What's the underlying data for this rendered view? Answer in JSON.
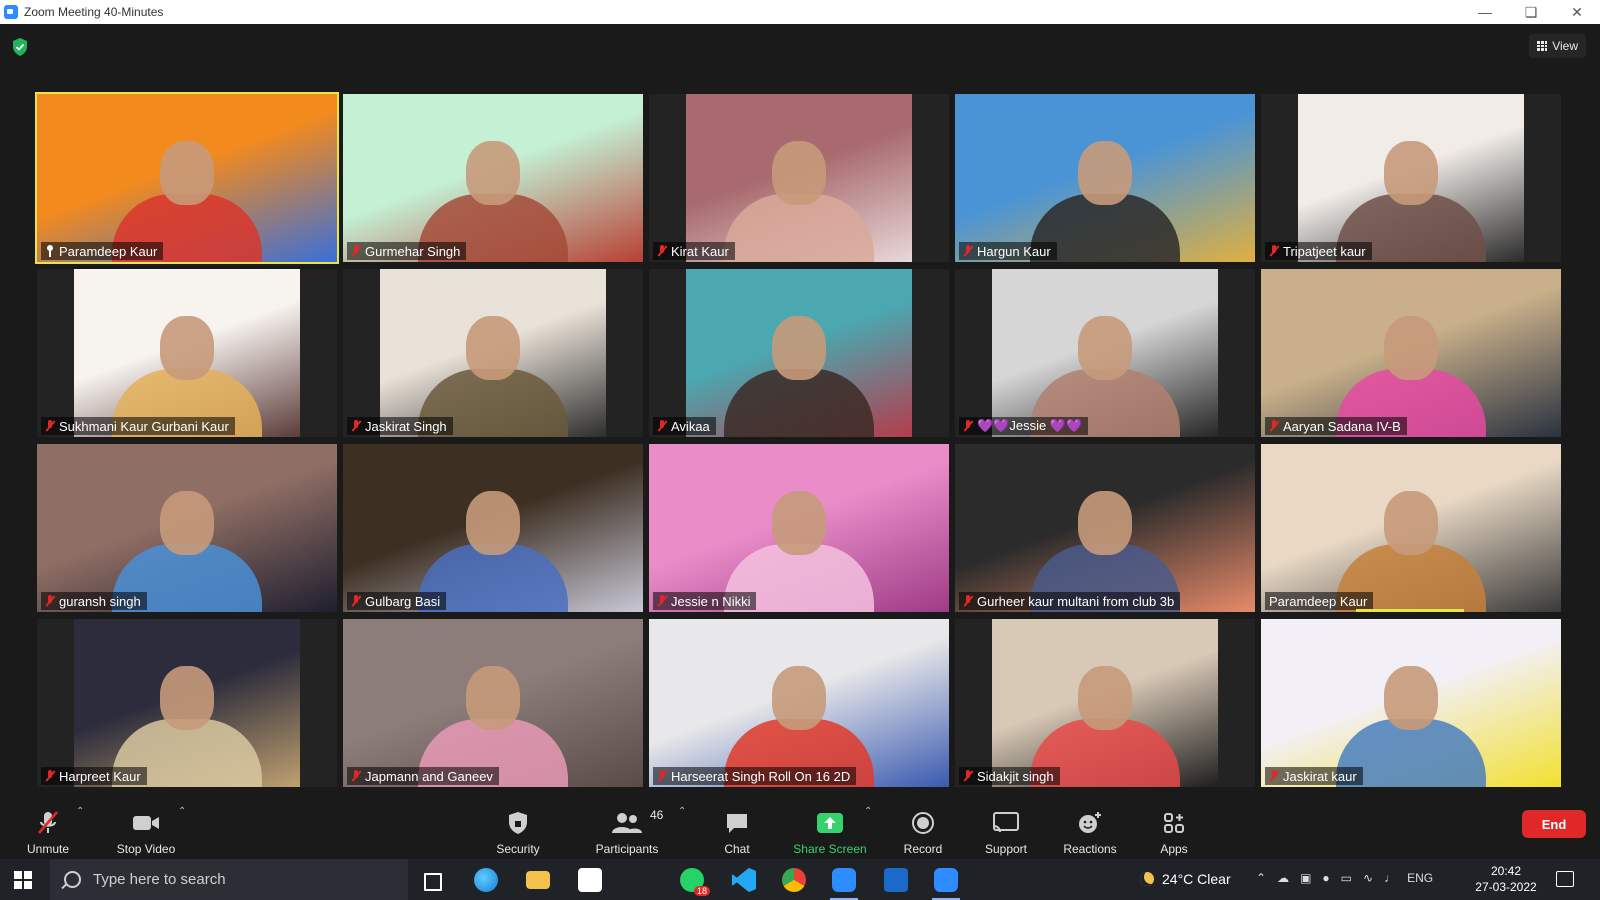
{
  "window": {
    "title": "Zoom Meeting 40-Minutes"
  },
  "header": {
    "view_label": "View"
  },
  "participants": [
    {
      "name": "Paramdeep Kaur",
      "icon": "pin-icon",
      "active": true,
      "colors": [
        "#f28a1e",
        "#d9362c",
        "#3a6fd8"
      ]
    },
    {
      "name": "Gurmehar Singh",
      "icon": "mic-muted-icon",
      "colors": [
        "#c4f0d4",
        "#a54b3a",
        "#b84033"
      ]
    },
    {
      "name": "Kirat Kaur",
      "icon": "mic-muted-icon",
      "narrow": true,
      "colors": [
        "#a86a6e",
        "#d9a99a",
        "#e8d8d8"
      ]
    },
    {
      "name": "Hargun Kaur",
      "icon": "mic-muted-icon",
      "colors": [
        "#4a94d6",
        "#2a2a2a",
        "#e0b040"
      ]
    },
    {
      "name": "Tripatjeet kaur",
      "icon": "mic-muted-icon",
      "narrow": true,
      "colors": [
        "#f1ece8",
        "#6e5048",
        "#2b2b2b"
      ]
    },
    {
      "name": "Sukhmani Kaur Gurbani Kaur",
      "icon": "mic-muted-icon",
      "narrow": true,
      "colors": [
        "#f7f3ef",
        "#e4b05a",
        "#5b3c3a"
      ]
    },
    {
      "name": "Jaskirat Singh",
      "icon": "mic-muted-icon",
      "narrow": true,
      "colors": [
        "#e9e2d8",
        "#6b5a3c",
        "#2e2e2e"
      ]
    },
    {
      "name": "Avikaa",
      "icon": "mic-muted-icon",
      "narrow": true,
      "colors": [
        "#4ba7b0",
        "#3b2a26",
        "#b43c4c"
      ]
    },
    {
      "name": "💜💜Jessie 💜💜",
      "icon": "mic-muted-icon",
      "narrow": true,
      "colors": [
        "#d6d6d6",
        "#b08070",
        "#262626"
      ]
    },
    {
      "name": "Aaryan Sadana IV-B",
      "icon": "mic-muted-icon",
      "colors": [
        "#c9b08a",
        "#e64aa2",
        "#2a3240"
      ]
    },
    {
      "name": "guransh singh",
      "icon": "mic-muted-icon",
      "colors": [
        "#8f6e64",
        "#4a8fd6",
        "#1f1f2f"
      ]
    },
    {
      "name": "Gulbarg Basi",
      "icon": "mic-muted-icon",
      "colors": [
        "#3d2f22",
        "#4a6fbf",
        "#c8c8d6"
      ]
    },
    {
      "name": "Jessie n Nikki",
      "icon": "mic-muted-icon",
      "colors": [
        "#e98cc8",
        "#f3c1df",
        "#9e3c86"
      ]
    },
    {
      "name": "Gurheer kaur multani from club 3b",
      "icon": "mic-muted-icon",
      "colors": [
        "#2b2b2b",
        "#4a5a8a",
        "#e88a6a"
      ]
    },
    {
      "name": "Paramdeep Kaur",
      "icon": "none",
      "speaking": true,
      "colors": [
        "#e8d8c4",
        "#c4803a",
        "#3a3a3a"
      ]
    },
    {
      "name": "Harpreet Kaur",
      "icon": "mic-muted-icon",
      "narrow": true,
      "colors": [
        "#2c2c3c",
        "#d8c8a0",
        "#c0a070"
      ]
    },
    {
      "name": "Japmann and Ganeev",
      "icon": "mic-muted-icon",
      "colors": [
        "#8c7c7a",
        "#e89ab6",
        "#5a4a48"
      ]
    },
    {
      "name": "Harseerat Singh Roll On 16 2D",
      "icon": "mic-muted-icon",
      "colors": [
        "#e8e8ea",
        "#e03a2a",
        "#3a5ab0"
      ]
    },
    {
      "name": "Sidakjit singh",
      "icon": "mic-muted-icon",
      "narrow": true,
      "colors": [
        "#d8c8b6",
        "#e84a4a",
        "#1f1f1f"
      ]
    },
    {
      "name": "Jaskirat kaur",
      "icon": "mic-muted-icon",
      "colors": [
        "#f2f0f6",
        "#4a7fc0",
        "#f2e030"
      ]
    }
  ],
  "toolbar": {
    "unmute": "Unmute",
    "stop_video": "Stop Video",
    "security": "Security",
    "participants": "Participants",
    "participant_count": "46",
    "chat": "Chat",
    "share_screen": "Share Screen",
    "record": "Record",
    "support": "Support",
    "reactions": "Reactions",
    "apps": "Apps",
    "end": "End",
    "share_color": "#36d36c",
    "end_color": "#e02828"
  },
  "taskbar": {
    "search_placeholder": "Type here to search",
    "whatsapp_badge": "18",
    "weather": "24°C Clear",
    "language": "ENG",
    "time": "20:42",
    "date": "27-03-2022"
  }
}
